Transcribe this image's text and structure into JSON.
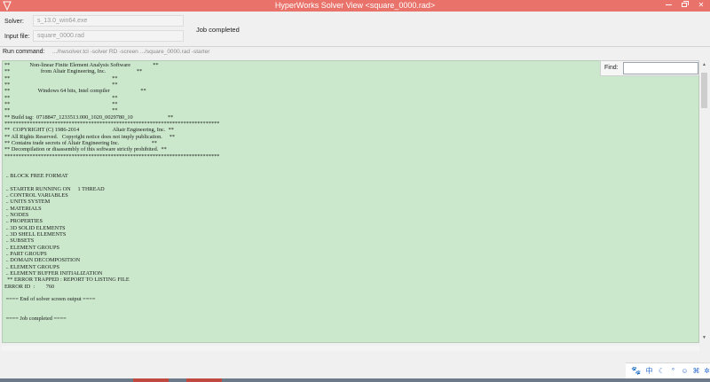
{
  "window": {
    "title": "HyperWorks Solver View <square_0000.rad>",
    "icons": {
      "app": "app-icon",
      "minimize": "minimize-icon",
      "maximize": "maximize-icon",
      "close": "close-icon"
    },
    "accent": "#e9726a"
  },
  "info": {
    "solver_label": "Solver:",
    "solver_value": "s_13.0_win64.exe",
    "input_label": "Input file:",
    "input_value": "square_0000.rad",
    "status": "Job completed",
    "run_label": "Run command:",
    "run_value": ".../hwsolver.tcl -solver RD -screen .../square_0000.rad -starter"
  },
  "find": {
    "label": "Find:",
    "value": ""
  },
  "console": {
    "background": "#cbe8cc",
    "lines": [
      "**              Non-linear Finite Element Analysis Software                **",
      "**                      from Altair Engineering, Inc.                      **",
      "**                                                                         **",
      "**                                                                         **",
      "**                    Windows 64 bits, Intel compiler                      **",
      "**                                                                         **",
      "**                                                                         **",
      "**                                                                         **",
      "** Build tag:  0718847_1233513.000_1020_0029780_10                         **",
      "*****************************************************************************",
      "**  COPYRIGHT (C) 1986-2014                        Altair Engineering, Inc.  **",
      "** All Rights Reserved.   Copyright notice does not imply publication.     **",
      "** Contains trade secrets of Altair Engineering Inc.                       **",
      "** Decompilation or disassembly of this software strictly prohibited.  **",
      "*****************************************************************************",
      "",
      "",
      " .. BLOCK FREE FORMAT",
      "",
      " .. STARTER RUNNING ON     1 THREAD",
      " .. CONTROL VARIABLES",
      " .. UNITS SYSTEM",
      " .. MATERIALS",
      " .. NODES",
      " .. PROPERTIES",
      " .. 3D SOLID ELEMENTS",
      " .. 3D SHELL ELEMENTS",
      " .. SUBSETS",
      " .. ELEMENT GROUPS",
      " .. PART GROUPS",
      " .. DOMAIN DECOMPOSITION",
      " .. ELEMENT GROUPS",
      " .. ELEMENT BUFFER INITIALIZATION",
      "  ** ERROR TRAPPED : REPORT TO LISTING FILE",
      "ERROR ID  :        760",
      "",
      " ==== End of solver screen output ====",
      "",
      "",
      " ==== Job completed ===="
    ]
  },
  "tray": {
    "zh": "中",
    "icons": [
      "paw-icon",
      "ime-zh-icon",
      "moon-icon",
      "dot-icon",
      "emoji-icon",
      "shirt-icon",
      "gear-icon"
    ]
  }
}
